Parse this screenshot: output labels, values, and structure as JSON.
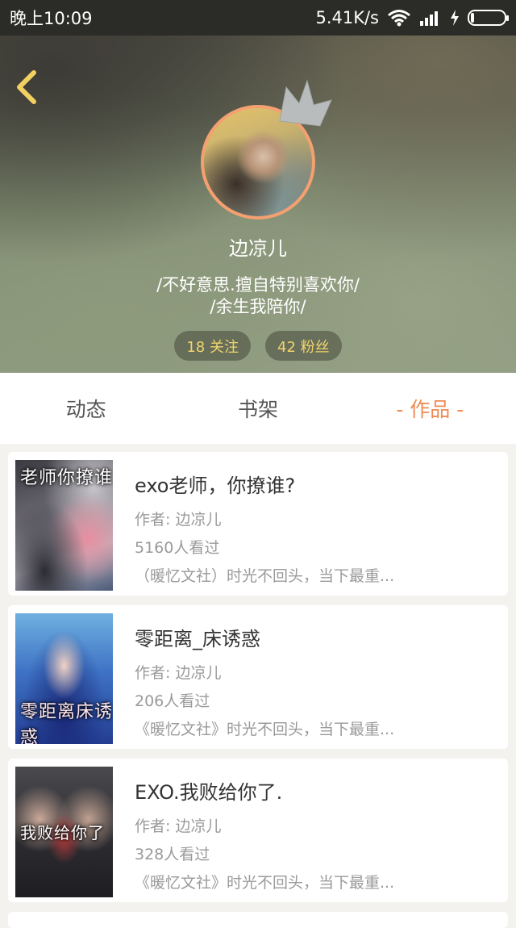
{
  "status_bar": {
    "time": "晚上10:09",
    "network_speed": "5.41K/s",
    "icons": [
      "wifi-icon",
      "signal-icon",
      "charging-icon",
      "battery-icon"
    ],
    "battery_level": 0.08
  },
  "profile": {
    "back_icon": "chevron-left-icon",
    "crown_icon": "crown-icon",
    "username": "边凉儿",
    "bio_line1": "/不好意思.擅自特别喜欢你/",
    "bio_line2": "/余生我陪你/",
    "following": "18 关注",
    "followers": "42 粉丝"
  },
  "tabs": [
    {
      "label": "动态",
      "active": false
    },
    {
      "label": "书架",
      "active": false
    },
    {
      "label": "- 作品 -",
      "active": true
    }
  ],
  "books": [
    {
      "title": "exo老师，你撩谁?",
      "author": "作者: 边凉儿",
      "views": "5160人看过",
      "desc": "（暖忆文社）时光不回头，当下最重...",
      "cover_text": "老师你撩谁"
    },
    {
      "title": "零距离_床诱惑",
      "author": "作者: 边凉儿",
      "views": "206人看过",
      "desc": "《暖忆文社》时光不回头，当下最重...",
      "cover_text": "零距离床诱惑"
    },
    {
      "title": "EXO.我败给你了.",
      "author": "作者: 边凉儿",
      "views": "328人看过",
      "desc": "《暖忆文社》时光不回头，当下最重...",
      "cover_text": "我败给你了"
    }
  ],
  "colors": {
    "accent": "#f08a52",
    "stat_text": "#f1d46b",
    "avatar_border": "#f4a071"
  }
}
